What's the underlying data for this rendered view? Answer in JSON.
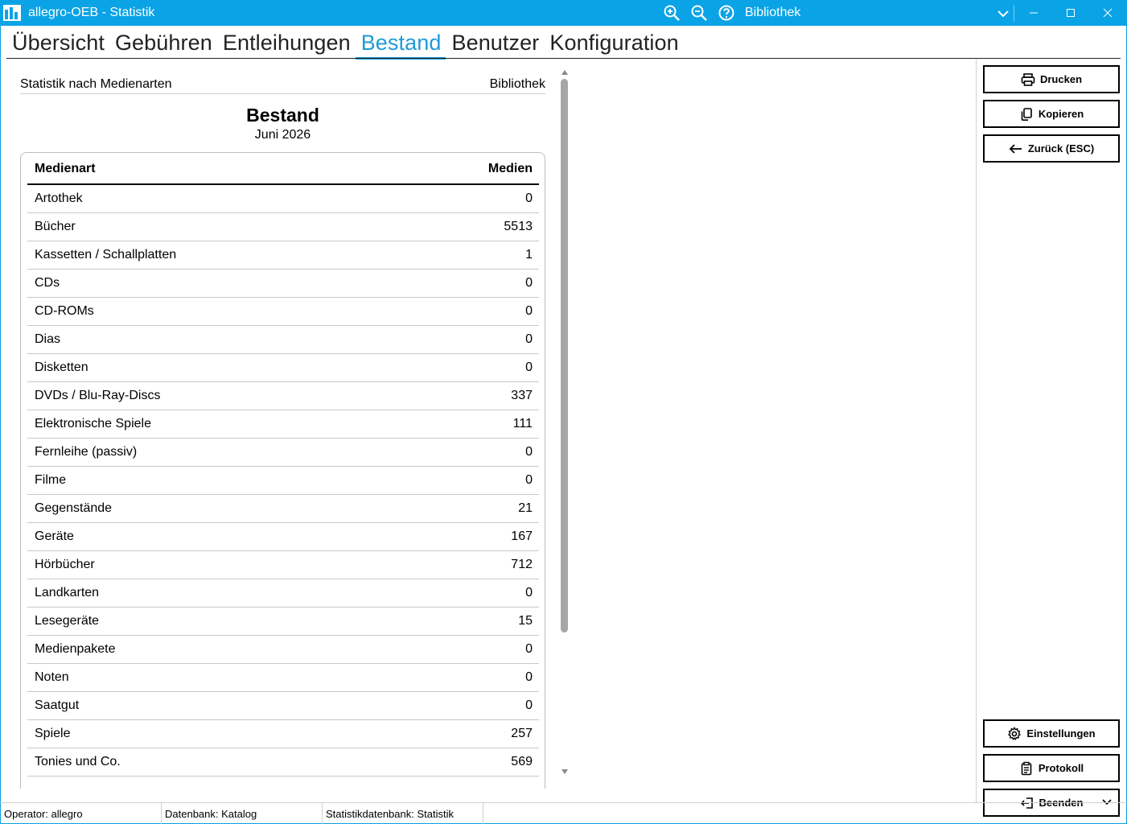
{
  "window": {
    "title": "allegro-OEB - Statistik",
    "library_selector": "Bibliothek",
    "accent": "#0aa3e6"
  },
  "tabs": [
    {
      "label": "Übersicht",
      "active": false
    },
    {
      "label": "Gebühren",
      "active": false
    },
    {
      "label": "Entleihungen",
      "active": false
    },
    {
      "label": "Bestand",
      "active": true
    },
    {
      "label": "Benutzer",
      "active": false
    },
    {
      "label": "Konfiguration",
      "active": false
    }
  ],
  "report": {
    "header_left": "Statistik nach Medienarten",
    "header_right": "Bibliothek",
    "title": "Bestand",
    "subtitle": "Juni 2026",
    "columns": [
      "Medienart",
      "Medien"
    ],
    "rows": [
      [
        "Artothek",
        "0"
      ],
      [
        "Bücher",
        "5513"
      ],
      [
        "Kassetten / Schallplatten",
        "1"
      ],
      [
        "CDs",
        "0"
      ],
      [
        "CD-ROMs",
        "0"
      ],
      [
        "Dias",
        "0"
      ],
      [
        "Disketten",
        "0"
      ],
      [
        "DVDs / Blu-Ray-Discs",
        "337"
      ],
      [
        "Elektronische Spiele",
        "111"
      ],
      [
        "Fernleihe (passiv)",
        "0"
      ],
      [
        "Filme",
        "0"
      ],
      [
        "Gegenstände",
        "21"
      ],
      [
        "Geräte",
        "167"
      ],
      [
        "Hörbücher",
        "712"
      ],
      [
        "Landkarten",
        "0"
      ],
      [
        "Lesegeräte",
        "15"
      ],
      [
        "Medienpakete",
        "0"
      ],
      [
        "Noten",
        "0"
      ],
      [
        "Saatgut",
        "0"
      ],
      [
        "Spiele",
        "257"
      ],
      [
        "Tonies und Co.",
        "569"
      ]
    ]
  },
  "buttons": {
    "print": "Drucken",
    "copy": "Kopieren",
    "back": "Zurück (ESC)",
    "settings": "Einstellungen",
    "log": "Protokoll",
    "quit": "Beenden"
  },
  "status": {
    "operator": "Operator: allegro",
    "database": "Datenbank: Katalog",
    "stats_db": "Statistikdatenbank: Statistik"
  }
}
